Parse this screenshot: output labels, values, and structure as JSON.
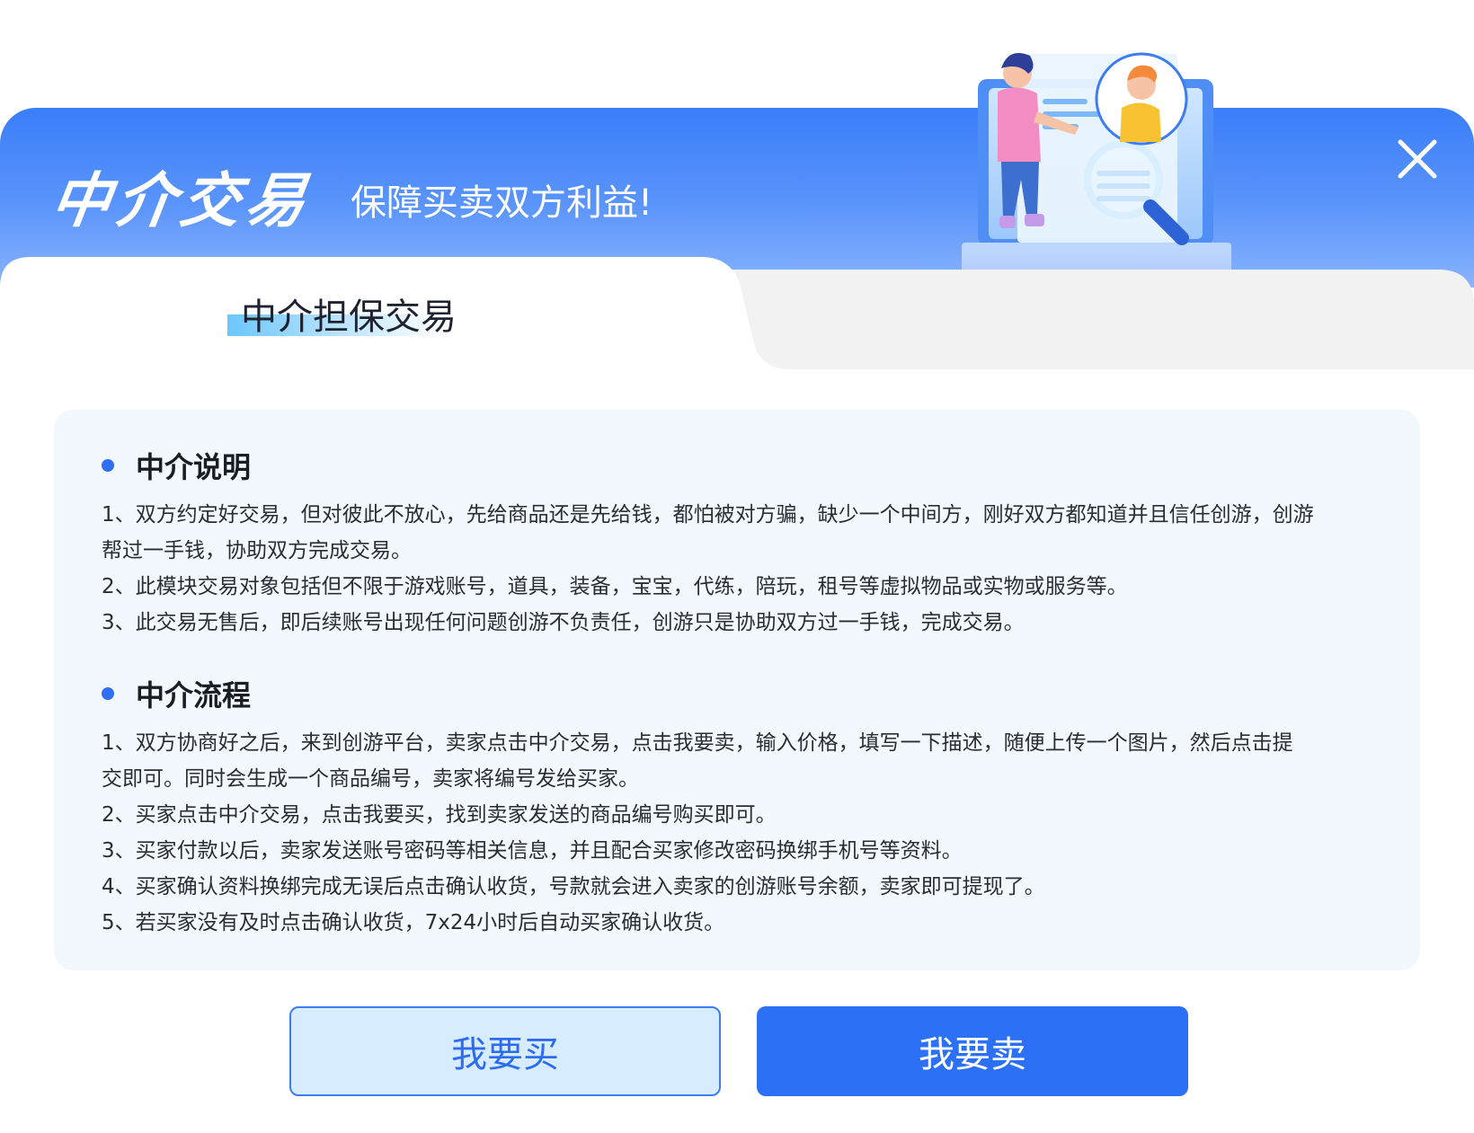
{
  "header": {
    "brand_title": "中介交易",
    "subtitle": "保障买卖双方利益!",
    "close_icon": "close-icon"
  },
  "tab": {
    "active_label": "中介担保交易"
  },
  "sections": [
    {
      "title": "中介说明",
      "lines": [
        "1、双方约定好交易，但对彼此不放心，先给商品还是先给钱，都怕被对方骗，缺少一个中间方，刚好双方都知道并且信任创游，创游",
        "帮过一手钱，协助双方完成交易。",
        "2、此模块交易对象包括但不限于游戏账号，道具，装备，宝宝，代练，陪玩，租号等虚拟物品或实物或服务等。",
        "3、此交易无售后，即后续账号出现任何问题创游不负责任，创游只是协助双方过一手钱，完成交易。"
      ]
    },
    {
      "title": "中介流程",
      "lines": [
        "1、双方协商好之后，来到创游平台，卖家点击中介交易，点击我要卖，输入价格，填写一下描述，随便上传一个图片，然后点击提",
        "交即可。同时会生成一个商品编号，卖家将编号发给买家。",
        "2、买家点击中介交易，点击我要买，找到卖家发送的商品编号购买即可。",
        "3、买家付款以后，卖家发送账号密码等相关信息，并且配合买家修改密码换绑手机号等资料。",
        "4、买家确认资料换绑完成无误后点击确认收货，号款就会进入卖家的创游账号余额，卖家即可提现了。",
        "5、若买家没有及时点击确认收货，7x24小时后自动买家确认收货。"
      ]
    }
  ],
  "buttons": {
    "buy_label": "我要买",
    "sell_label": "我要卖"
  },
  "colors": {
    "primary": "#2c70f6",
    "header_gradient_top": "#3a7ef9",
    "card_bg": "#f3f7fe",
    "buy_bg": "#d7ecfe"
  }
}
